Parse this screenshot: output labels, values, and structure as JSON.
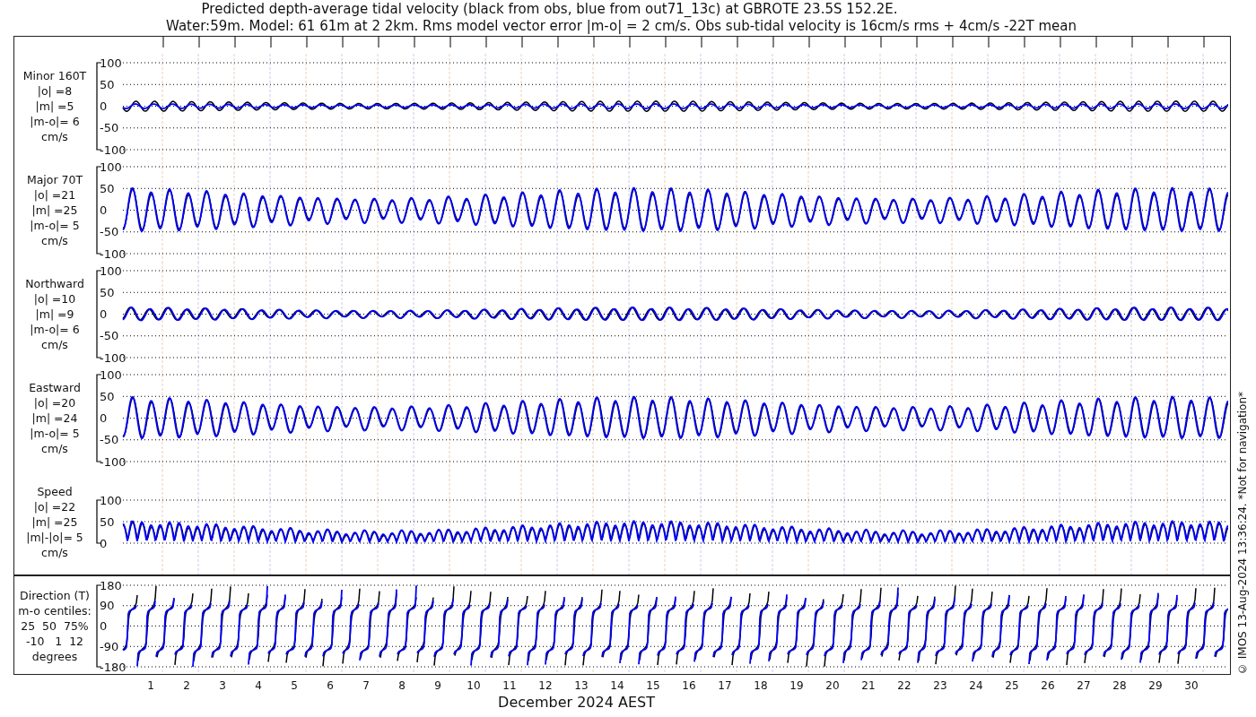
{
  "title": {
    "line_1": "Predicted depth-average tidal velocity (black from obs, blue from out71_13c) at GBROTE 23.5S 152.2E.",
    "line_2": "Water:59m. Model: 61 61m at 2 2km. Rms model vector error |m-o| = 2 cm/s. Obs sub-tidal velocity is 16cm/s rms + 4cm/s -22T mean"
  },
  "panels": [
    {
      "kind": "minor",
      "label_lines": [
        "Minor 160T",
        "|o| =8",
        "|m| =5",
        "|m-o|= 6",
        "cm/s"
      ],
      "yticks": [
        "100",
        "50",
        "0",
        "-50",
        "-100"
      ]
    },
    {
      "kind": "major",
      "label_lines": [
        "Major 70T",
        "|o| =21",
        "|m| =25",
        "|m-o|= 5",
        "cm/s"
      ],
      "yticks": [
        "100",
        "50",
        "0",
        "-50",
        "-100"
      ]
    },
    {
      "kind": "northward",
      "label_lines": [
        "Northward",
        "|o| =10",
        "|m| =9",
        "|m-o|= 6",
        "cm/s"
      ],
      "yticks": [
        "100",
        "50",
        "0",
        "-50",
        "-100"
      ]
    },
    {
      "kind": "eastward",
      "label_lines": [
        "Eastward",
        "|o| =20",
        "|m| =24",
        "|m-o|= 5",
        "cm/s"
      ],
      "yticks": [
        "100",
        "50",
        "0",
        "-50",
        "-100"
      ]
    },
    {
      "kind": "speed",
      "label_lines": [
        "Speed",
        "|o| =22",
        "|m| =25",
        "|m|-|o|= 5",
        "cm/s"
      ],
      "yticks": [
        "100",
        "50",
        "0"
      ]
    },
    {
      "kind": "direction",
      "label_lines": [
        "Direction (T)",
        "m-o centiles:",
        "25  50  75%",
        "-10   1  12",
        "degrees"
      ],
      "yticks": [
        "180",
        "90",
        "0",
        "-90",
        "-180"
      ]
    }
  ],
  "x_axis": {
    "day_labels": [
      "1",
      "2",
      "3",
      "4",
      "5",
      "6",
      "7",
      "8",
      "9",
      "10",
      "11",
      "12",
      "13",
      "14",
      "15",
      "16",
      "17",
      "18",
      "19",
      "20",
      "21",
      "22",
      "23",
      "24",
      "25",
      "26",
      "27",
      "28",
      "29",
      "30"
    ],
    "label": "December 2024 AEST"
  },
  "side_note": "© IMOS 13-Aug-2024 13:36:24. *Not for navigation*"
}
